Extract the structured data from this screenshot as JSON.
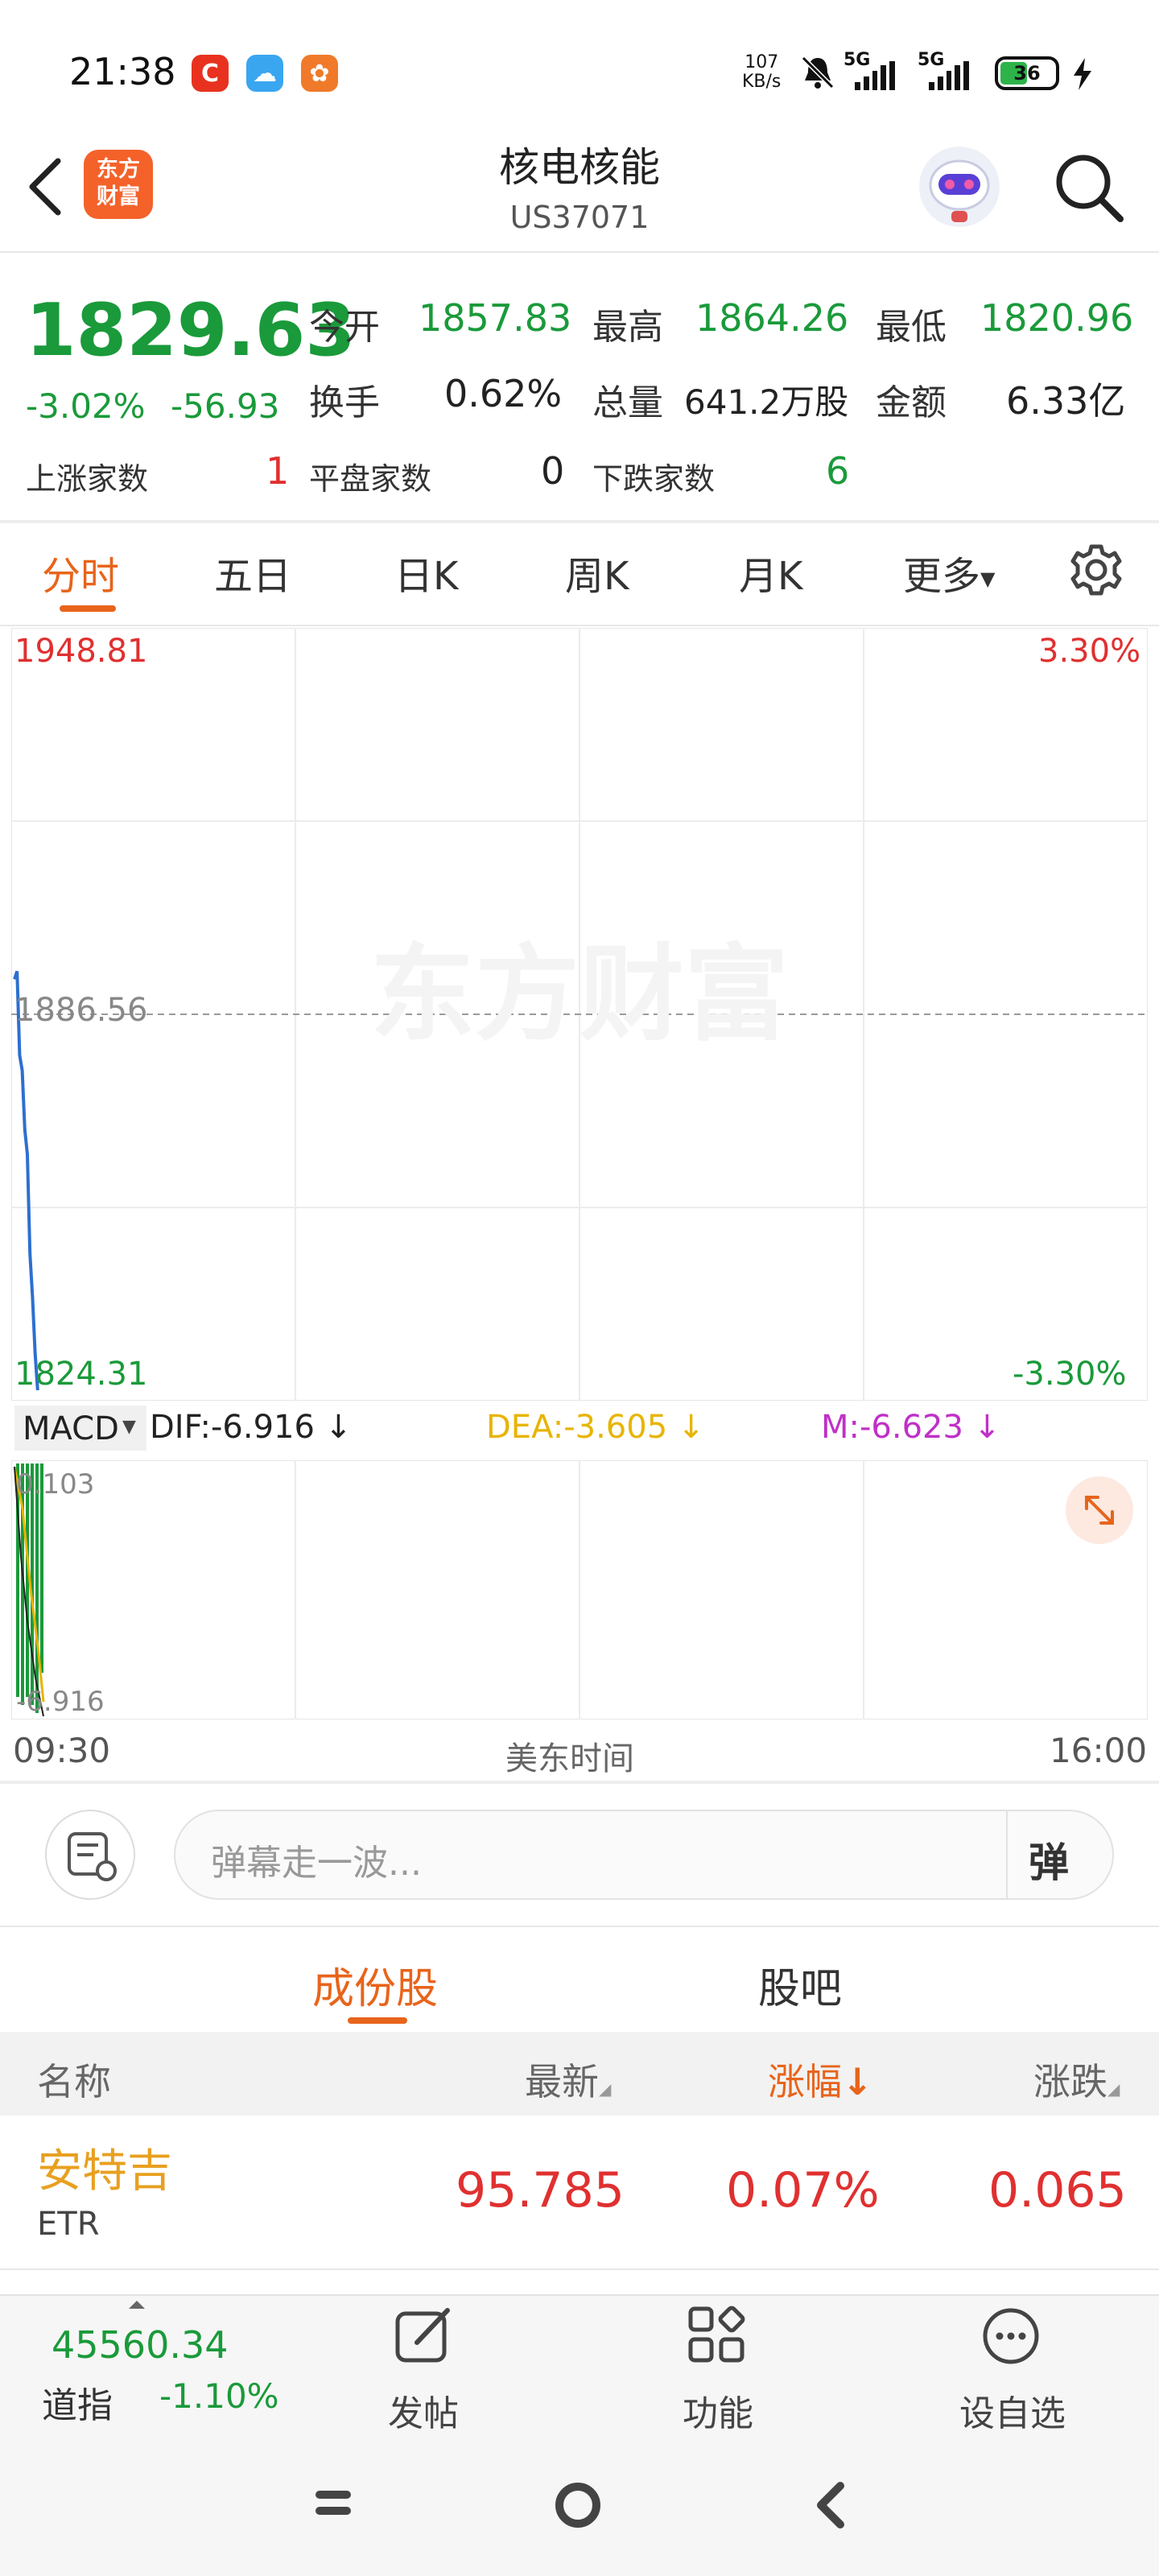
{
  "status_bar": {
    "time": "21:38",
    "app_icons": [
      {
        "name": "c-app-icon",
        "glyph": "C",
        "color": "#e8321f"
      },
      {
        "name": "cloud-app-icon",
        "glyph": "☁",
        "color": "#3aa6f0"
      },
      {
        "name": "grid-app-icon",
        "glyph": "✿",
        "color": "#f07a2a"
      }
    ],
    "net_speed_value": "107",
    "net_speed_unit": "KB/s",
    "sim1": "5G",
    "sim2": "5G",
    "battery": "36"
  },
  "header": {
    "title": "核电核能",
    "code": "US37071",
    "logo_text_1": "东方",
    "logo_text_2": "财富"
  },
  "quote": {
    "price": "1829.63",
    "change_pct": "-3.02%",
    "change": "-56.93",
    "open_label": "今开",
    "open": "1857.83",
    "high_label": "最高",
    "high": "1864.26",
    "low_label": "最低",
    "low": "1820.96",
    "turnover_label": "换手",
    "turnover": "0.62%",
    "volume_label": "总量",
    "volume": "641.2万股",
    "amount_label": "金额",
    "amount": "6.33亿",
    "up_label": "上涨家数",
    "up_count": "1",
    "flat_label": "平盘家数",
    "flat_count": "0",
    "down_label": "下跌家数",
    "down_count": "6"
  },
  "tabs": [
    "分时",
    "五日",
    "日K",
    "周K",
    "月K",
    "更多"
  ],
  "chart": {
    "top_price": "1948.81",
    "top_pct": "3.30%",
    "mid_price": "1886.56",
    "bottom_price": "1824.31",
    "bottom_pct": "-3.30%",
    "watermark": "东方财富",
    "price_line": [
      [
        0,
        1892.2
      ],
      [
        1,
        1893.5
      ],
      [
        2,
        1880.0
      ],
      [
        3,
        1877.5
      ],
      [
        4,
        1868.0
      ],
      [
        5,
        1864.0
      ],
      [
        6,
        1848.0
      ],
      [
        7,
        1841.0
      ],
      [
        8,
        1832.0
      ],
      [
        9,
        1826.0
      ]
    ],
    "macd_indicator": "MACD",
    "dif_label": "DIF:-6.916",
    "dea_label": "DEA:-3.605",
    "m_label": "M:-6.623",
    "macd_top": "0.103",
    "macd_bottom": "-6.916",
    "time_start": "09:30",
    "time_mid": "美东时间",
    "time_end": "16:00"
  },
  "comment": {
    "placeholder": "弹幕走一波...",
    "danmaku_button": "弹"
  },
  "subtabs": [
    "成份股",
    "股吧"
  ],
  "table": {
    "headers": {
      "name": "名称",
      "latest": "最新",
      "change_pct": "涨幅",
      "change": "涨跌"
    },
    "rows": [
      {
        "name": "安特吉",
        "code": "ETR",
        "latest": "95.785",
        "change_pct": "0.07%",
        "change": "0.065"
      }
    ]
  },
  "bottom_bar": {
    "index_value": "45560.34",
    "index_name": "道指",
    "index_change": "-1.10%",
    "post": "发帖",
    "functions": "功能",
    "watchlist": "设自选"
  }
}
